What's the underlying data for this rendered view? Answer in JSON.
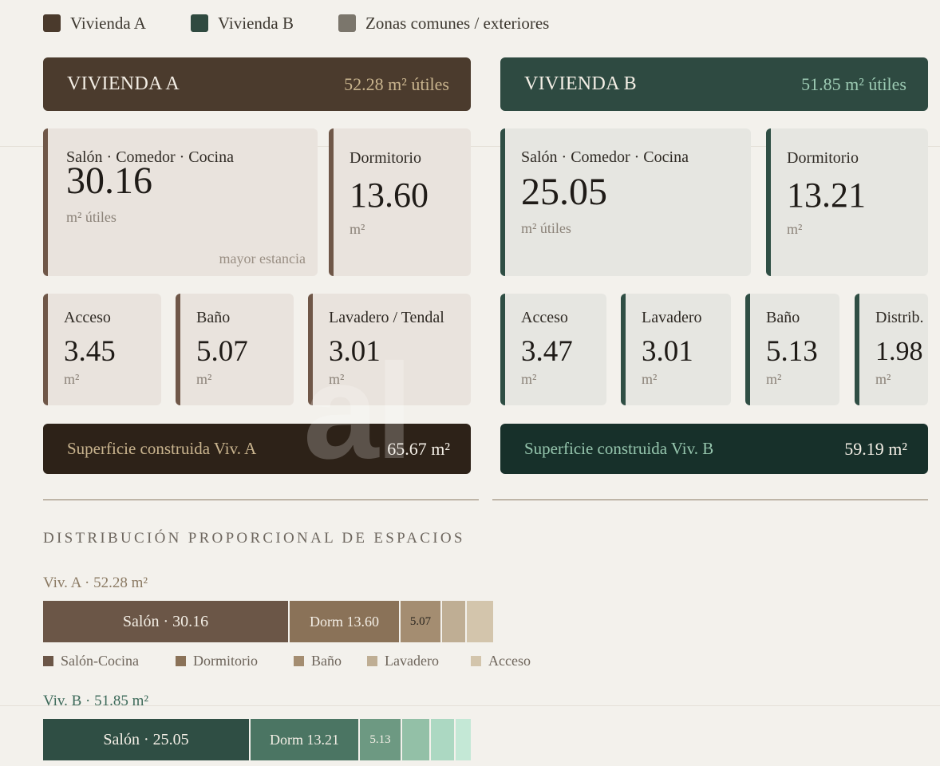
{
  "legend": [
    {
      "label": "Vivienda A",
      "color": "#4a3a2c"
    },
    {
      "label": "Vivienda B",
      "color": "#2f4a40"
    },
    {
      "label": "Zonas comunes / exteriores",
      "color": "#7b766c"
    }
  ],
  "vivienda_a": {
    "title": "VIVIENDA A",
    "area": "52.28 m² útiles",
    "main_room": {
      "name": "Salón · Comedor · Cocina",
      "value": "30.16",
      "unit": "m² útiles",
      "note": "mayor estancia"
    },
    "bedroom": {
      "name": "Dormitorio",
      "value": "13.60",
      "unit": "m²"
    },
    "small_rooms": [
      {
        "name": "Acceso",
        "value": "3.45",
        "unit": "m²"
      },
      {
        "name": "Baño",
        "value": "5.07",
        "unit": "m²"
      },
      {
        "name": "Lavadero / Tendal",
        "value": "3.01",
        "unit": "m²"
      }
    ],
    "total_label": "Superficie construida Viv. A",
    "total_value": "65.67 m²"
  },
  "vivienda_b": {
    "title": "VIVIENDA B",
    "area": "51.85 m² útiles",
    "main_room": {
      "name": "Salón · Comedor · Cocina",
      "value": "25.05",
      "unit": "m² útiles"
    },
    "bedroom": {
      "name": "Dormitorio",
      "value": "13.21",
      "unit": "m²"
    },
    "small_rooms": [
      {
        "name": "Acceso",
        "value": "3.47",
        "unit": "m²"
      },
      {
        "name": "Lavadero",
        "value": "3.01",
        "unit": "m²"
      },
      {
        "name": "Baño",
        "value": "5.13",
        "unit": "m²"
      },
      {
        "name": "Distrib.",
        "value": "1.98",
        "unit": "m²"
      }
    ],
    "total_label": "Superficie construida Viv. B",
    "total_value": "59.19 m²"
  },
  "distribution": {
    "title": "DISTRIBUCIÓN PROPORCIONAL DE ESPACIOS",
    "row_a": {
      "label": "Viv. A · 52.28 m²",
      "segments": [
        {
          "label": "Salón · 30.16",
          "value": 30.16,
          "color": "#6b5647"
        },
        {
          "label": "Dorm 13.60",
          "value": 13.6,
          "color": "#8a7258"
        },
        {
          "label": "5.07",
          "value": 5.07,
          "color": "#a48d71"
        },
        {
          "label": "",
          "value": 3.01,
          "color": "#bfae94"
        },
        {
          "label": "",
          "value": 3.45,
          "color": "#d3c5ac"
        }
      ],
      "legend": [
        {
          "label": "Salón-Cocina",
          "color": "#6b5647"
        },
        {
          "label": "Dormitorio",
          "color": "#8a7258"
        },
        {
          "label": "Baño",
          "color": "#a48d71"
        },
        {
          "label": "Lavadero",
          "color": "#bfae94"
        },
        {
          "label": "Acceso",
          "color": "#d3c5ac"
        }
      ]
    },
    "row_b": {
      "label": "Viv. B · 51.85 m²",
      "segments": [
        {
          "label": "Salón · 25.05",
          "value": 25.05,
          "color": "#2f4e44"
        },
        {
          "label": "Dorm 13.21",
          "value": 13.21,
          "color": "#4b7563"
        },
        {
          "label": "5.13",
          "value": 5.13,
          "color": "#6d9982"
        },
        {
          "label": "",
          "value": 3.47,
          "color": "#93c0a7"
        },
        {
          "label": "",
          "value": 3.01,
          "color": "#acd8c2"
        },
        {
          "label": "",
          "value": 1.98,
          "color": "#c4e8d6"
        }
      ]
    }
  }
}
